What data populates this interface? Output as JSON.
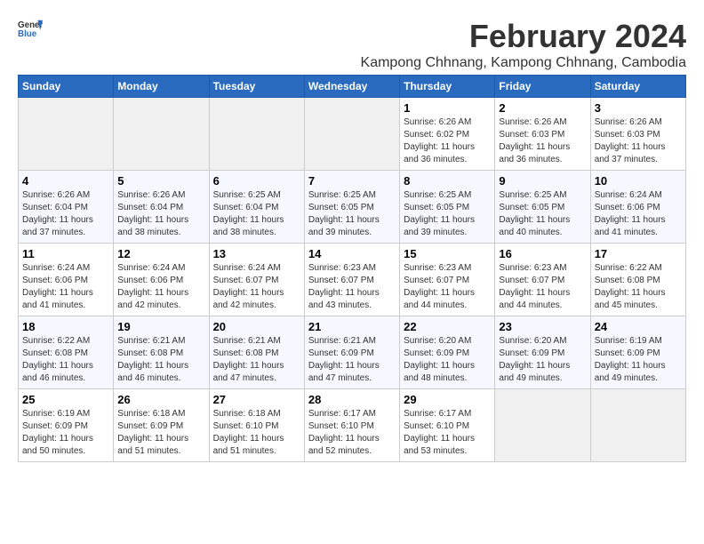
{
  "header": {
    "logo_line1": "General",
    "logo_line2": "Blue",
    "main_title": "February 2024",
    "subtitle": "Kampong Chhnang, Kampong Chhnang, Cambodia"
  },
  "days_of_week": [
    "Sunday",
    "Monday",
    "Tuesday",
    "Wednesday",
    "Thursday",
    "Friday",
    "Saturday"
  ],
  "weeks": [
    [
      {
        "num": "",
        "detail": ""
      },
      {
        "num": "",
        "detail": ""
      },
      {
        "num": "",
        "detail": ""
      },
      {
        "num": "",
        "detail": ""
      },
      {
        "num": "1",
        "detail": "Sunrise: 6:26 AM\nSunset: 6:02 PM\nDaylight: 11 hours\nand 36 minutes."
      },
      {
        "num": "2",
        "detail": "Sunrise: 6:26 AM\nSunset: 6:03 PM\nDaylight: 11 hours\nand 36 minutes."
      },
      {
        "num": "3",
        "detail": "Sunrise: 6:26 AM\nSunset: 6:03 PM\nDaylight: 11 hours\nand 37 minutes."
      }
    ],
    [
      {
        "num": "4",
        "detail": "Sunrise: 6:26 AM\nSunset: 6:04 PM\nDaylight: 11 hours\nand 37 minutes."
      },
      {
        "num": "5",
        "detail": "Sunrise: 6:26 AM\nSunset: 6:04 PM\nDaylight: 11 hours\nand 38 minutes."
      },
      {
        "num": "6",
        "detail": "Sunrise: 6:25 AM\nSunset: 6:04 PM\nDaylight: 11 hours\nand 38 minutes."
      },
      {
        "num": "7",
        "detail": "Sunrise: 6:25 AM\nSunset: 6:05 PM\nDaylight: 11 hours\nand 39 minutes."
      },
      {
        "num": "8",
        "detail": "Sunrise: 6:25 AM\nSunset: 6:05 PM\nDaylight: 11 hours\nand 39 minutes."
      },
      {
        "num": "9",
        "detail": "Sunrise: 6:25 AM\nSunset: 6:05 PM\nDaylight: 11 hours\nand 40 minutes."
      },
      {
        "num": "10",
        "detail": "Sunrise: 6:24 AM\nSunset: 6:06 PM\nDaylight: 11 hours\nand 41 minutes."
      }
    ],
    [
      {
        "num": "11",
        "detail": "Sunrise: 6:24 AM\nSunset: 6:06 PM\nDaylight: 11 hours\nand 41 minutes."
      },
      {
        "num": "12",
        "detail": "Sunrise: 6:24 AM\nSunset: 6:06 PM\nDaylight: 11 hours\nand 42 minutes."
      },
      {
        "num": "13",
        "detail": "Sunrise: 6:24 AM\nSunset: 6:07 PM\nDaylight: 11 hours\nand 42 minutes."
      },
      {
        "num": "14",
        "detail": "Sunrise: 6:23 AM\nSunset: 6:07 PM\nDaylight: 11 hours\nand 43 minutes."
      },
      {
        "num": "15",
        "detail": "Sunrise: 6:23 AM\nSunset: 6:07 PM\nDaylight: 11 hours\nand 44 minutes."
      },
      {
        "num": "16",
        "detail": "Sunrise: 6:23 AM\nSunset: 6:07 PM\nDaylight: 11 hours\nand 44 minutes."
      },
      {
        "num": "17",
        "detail": "Sunrise: 6:22 AM\nSunset: 6:08 PM\nDaylight: 11 hours\nand 45 minutes."
      }
    ],
    [
      {
        "num": "18",
        "detail": "Sunrise: 6:22 AM\nSunset: 6:08 PM\nDaylight: 11 hours\nand 46 minutes."
      },
      {
        "num": "19",
        "detail": "Sunrise: 6:21 AM\nSunset: 6:08 PM\nDaylight: 11 hours\nand 46 minutes."
      },
      {
        "num": "20",
        "detail": "Sunrise: 6:21 AM\nSunset: 6:08 PM\nDaylight: 11 hours\nand 47 minutes."
      },
      {
        "num": "21",
        "detail": "Sunrise: 6:21 AM\nSunset: 6:09 PM\nDaylight: 11 hours\nand 47 minutes."
      },
      {
        "num": "22",
        "detail": "Sunrise: 6:20 AM\nSunset: 6:09 PM\nDaylight: 11 hours\nand 48 minutes."
      },
      {
        "num": "23",
        "detail": "Sunrise: 6:20 AM\nSunset: 6:09 PM\nDaylight: 11 hours\nand 49 minutes."
      },
      {
        "num": "24",
        "detail": "Sunrise: 6:19 AM\nSunset: 6:09 PM\nDaylight: 11 hours\nand 49 minutes."
      }
    ],
    [
      {
        "num": "25",
        "detail": "Sunrise: 6:19 AM\nSunset: 6:09 PM\nDaylight: 11 hours\nand 50 minutes."
      },
      {
        "num": "26",
        "detail": "Sunrise: 6:18 AM\nSunset: 6:09 PM\nDaylight: 11 hours\nand 51 minutes."
      },
      {
        "num": "27",
        "detail": "Sunrise: 6:18 AM\nSunset: 6:10 PM\nDaylight: 11 hours\nand 51 minutes."
      },
      {
        "num": "28",
        "detail": "Sunrise: 6:17 AM\nSunset: 6:10 PM\nDaylight: 11 hours\nand 52 minutes."
      },
      {
        "num": "29",
        "detail": "Sunrise: 6:17 AM\nSunset: 6:10 PM\nDaylight: 11 hours\nand 53 minutes."
      },
      {
        "num": "",
        "detail": ""
      },
      {
        "num": "",
        "detail": ""
      }
    ]
  ]
}
